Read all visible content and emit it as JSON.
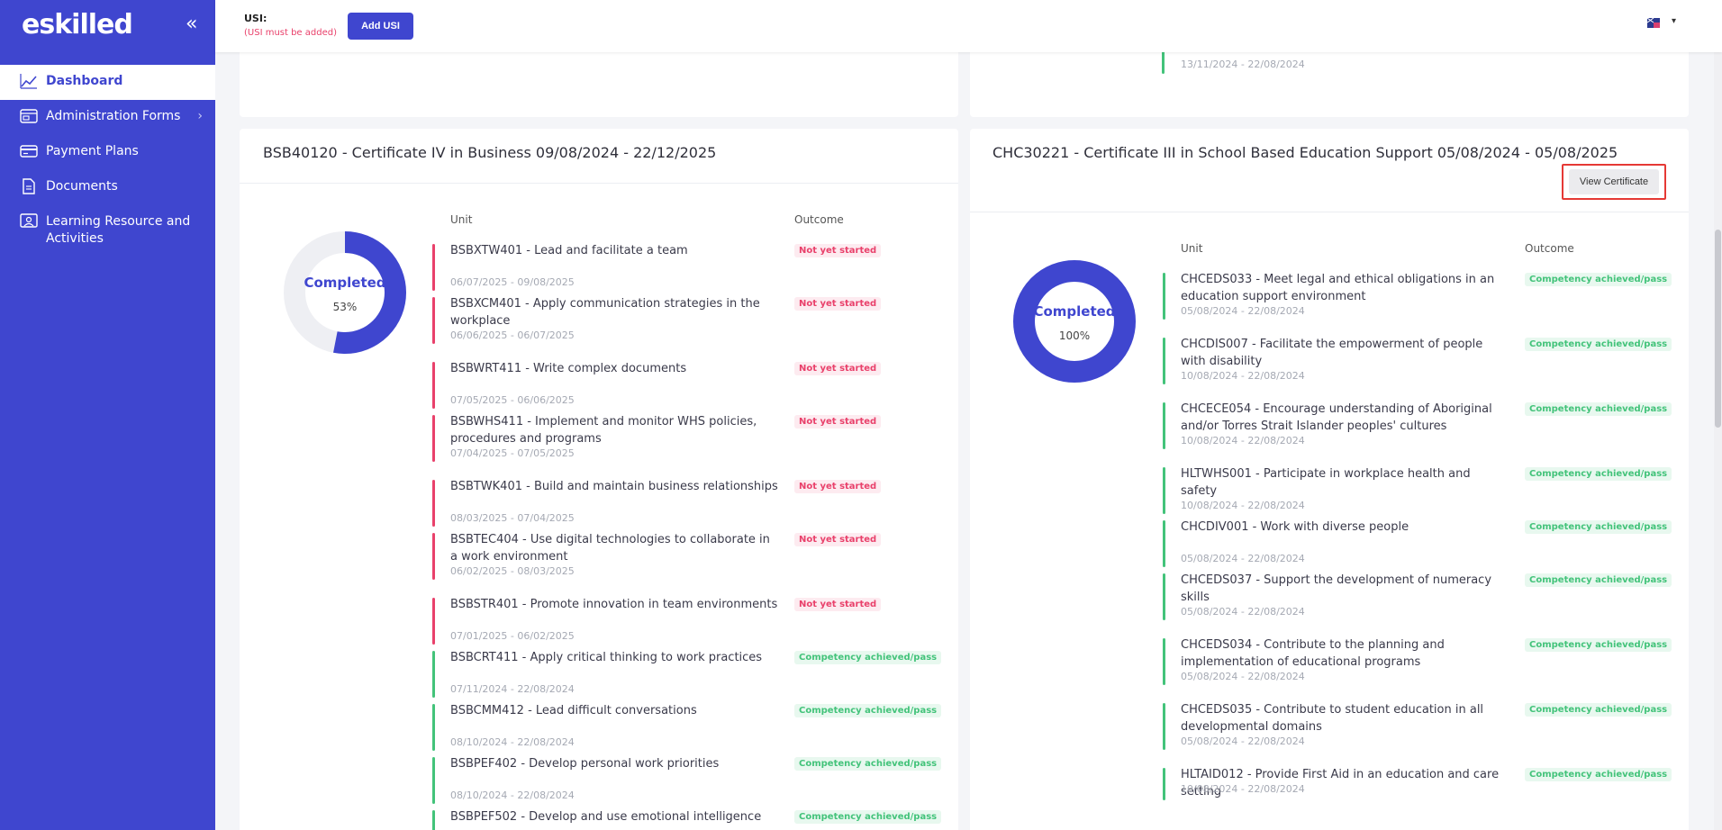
{
  "brand": {
    "logo": "eskilled"
  },
  "sidebar": {
    "items": [
      {
        "label": "Dashboard",
        "icon": "chart-line-icon"
      },
      {
        "label": "Administration Forms",
        "icon": "form-icon"
      },
      {
        "label": "Payment Plans",
        "icon": "credit-card-icon"
      },
      {
        "label": "Documents",
        "icon": "document-icon"
      },
      {
        "label": "Learning Resource and Activities",
        "icon": "presentation-icon"
      }
    ]
  },
  "topbar": {
    "usi_label": "USI:",
    "usi_note": "(USI must be added)",
    "add_usi": "Add USI"
  },
  "top_right_partial": {
    "date": "13/11/2024 - 22/08/2024"
  },
  "courses": [
    {
      "title": "BSB40120 - Certificate IV in Business 09/08/2024 - 22/12/2025",
      "status": "Completed",
      "percent": "53%",
      "percent_value": 53,
      "unit_header": "Unit",
      "outcome_header": "Outcome",
      "units": [
        {
          "name": "BSBXTW401 - Lead and facilitate a team",
          "date": "06/07/2025 - 09/08/2025",
          "outcome": "Not yet started",
          "status": "red"
        },
        {
          "name": "BSBXCM401 - Apply communication strategies in the workplace",
          "date": "06/06/2025 - 06/07/2025",
          "outcome": "Not yet started",
          "status": "red"
        },
        {
          "name": "BSBWRT411 - Write complex documents",
          "date": "07/05/2025 - 06/06/2025",
          "outcome": "Not yet started",
          "status": "red"
        },
        {
          "name": "BSBWHS411 - Implement and monitor WHS policies, procedures and programs",
          "date": "07/04/2025 - 07/05/2025",
          "outcome": "Not yet started",
          "status": "red"
        },
        {
          "name": "BSBTWK401 - Build and maintain business relationships",
          "date": "08/03/2025 - 07/04/2025",
          "outcome": "Not yet started",
          "status": "red"
        },
        {
          "name": "BSBTEC404 - Use digital technologies to collaborate in a work environment",
          "date": "06/02/2025 - 08/03/2025",
          "outcome": "Not yet started",
          "status": "red"
        },
        {
          "name": "BSBSTR401 - Promote innovation in team environments",
          "date": "07/01/2025 - 06/02/2025",
          "outcome": "Not yet started",
          "status": "red"
        },
        {
          "name": "BSBCRT411 - Apply critical thinking to work practices",
          "date": "07/11/2024 - 22/08/2024",
          "outcome": "Competency achieved/pass",
          "status": "green"
        },
        {
          "name": "BSBCMM412 - Lead difficult conversations",
          "date": "08/10/2024 - 22/08/2024",
          "outcome": "Competency achieved/pass",
          "status": "green"
        },
        {
          "name": "BSBPEF402 - Develop personal work priorities",
          "date": "08/10/2024 - 22/08/2024",
          "outcome": "Competency achieved/pass",
          "status": "green"
        },
        {
          "name": "BSBPEF502 - Develop and use emotional intelligence",
          "date": "",
          "outcome": "Competency achieved/pass",
          "status": "green"
        }
      ]
    },
    {
      "title": "CHC30221 - Certificate III in School Based Education Support 05/08/2024 - 05/08/2025",
      "status": "Completed",
      "percent": "100%",
      "percent_value": 100,
      "view_certificate": "View Certificate",
      "unit_header": "Unit",
      "outcome_header": "Outcome",
      "units": [
        {
          "name": "CHCEDS033 - Meet legal and ethical obligations in an education support environment",
          "date": "05/08/2024 - 22/08/2024",
          "outcome": "Competency achieved/pass",
          "status": "green"
        },
        {
          "name": "CHCDIS007 - Facilitate the empowerment of people with disability",
          "date": "10/08/2024 - 22/08/2024",
          "outcome": "Competency achieved/pass",
          "status": "green"
        },
        {
          "name": "CHCECE054 - Encourage understanding of Aboriginal and/or Torres Strait Islander peoples' cultures",
          "date": "10/08/2024 - 22/08/2024",
          "outcome": "Competency achieved/pass",
          "status": "green"
        },
        {
          "name": "HLTWHS001 - Participate in workplace health and safety",
          "date": "10/08/2024 - 22/08/2024",
          "outcome": "Competency achieved/pass",
          "status": "green"
        },
        {
          "name": "CHCDIV001 - Work with diverse people",
          "date": "05/08/2024 - 22/08/2024",
          "outcome": "Competency achieved/pass",
          "status": "green"
        },
        {
          "name": "CHCEDS037 - Support the development of numeracy skills",
          "date": "05/08/2024 - 22/08/2024",
          "outcome": "Competency achieved/pass",
          "status": "green"
        },
        {
          "name": "CHCEDS034 - Contribute to the planning and implementation of educational programs",
          "date": "05/08/2024 - 22/08/2024",
          "outcome": "Competency achieved/pass",
          "status": "green"
        },
        {
          "name": "CHCEDS035 - Contribute to student education in all developmental domains",
          "date": "05/08/2024 - 22/08/2024",
          "outcome": "Competency achieved/pass",
          "status": "green"
        },
        {
          "name": "HLTAID012 - Provide First Aid in an education and care setting",
          "date": "10/08/2024 - 22/08/2024",
          "outcome": "Competency achieved/pass",
          "status": "green"
        }
      ]
    }
  ],
  "colors": {
    "brand": "#3f46cf",
    "not_started": "#e9416b",
    "achieved": "#43c37a"
  }
}
